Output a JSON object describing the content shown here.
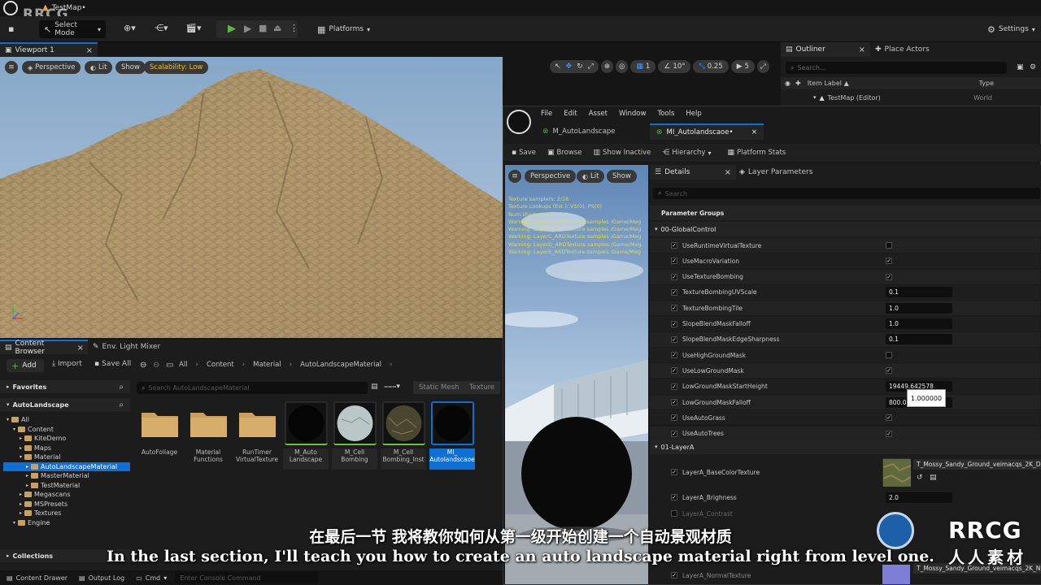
{
  "window": {
    "title": "TestMap•",
    "logo_text": "RRCG"
  },
  "toolbar": {
    "mode_label": "Select Mode",
    "platforms_label": "Platforms",
    "settings_label": "Settings"
  },
  "viewport": {
    "tab_label": "Viewport 1",
    "perspective_label": "Perspective",
    "lit_label": "Lit",
    "show_label": "Show",
    "scalability_label": "Scalability: Low",
    "grid_value": "1",
    "angle_value": "10°",
    "scale_value": "0.25",
    "camera_speed": "5"
  },
  "outliner": {
    "tab_label": "Outliner",
    "place_actors_label": "Place Actors",
    "search_placeholder": "Search...",
    "col_label": "Item Label ▲",
    "col_type": "Type",
    "row_label": "TestMap (Editor)",
    "row_type": "World"
  },
  "content_browser": {
    "tab_label": "Content Browser",
    "mixer_tab_label": "Env. Light Mixer",
    "add_label": "Add",
    "import_label": "Import",
    "save_all_label": "Save All",
    "breadcrumbs": [
      "All",
      "Content",
      "Material",
      "AutoLandscapeMaterial"
    ],
    "favorites_label": "Favorites",
    "project_label": "AutoLandscape",
    "search_placeholder": "Search AutoLandscapeMaterial",
    "filter_static_mesh": "Static Mesh",
    "filter_texture": "Texture",
    "tree": [
      {
        "label": "All",
        "level": 0,
        "selected": false
      },
      {
        "label": "Content",
        "level": 1,
        "selected": false
      },
      {
        "label": "KiteDemo",
        "level": 2,
        "selected": false
      },
      {
        "label": "Maps",
        "level": 2,
        "selected": false
      },
      {
        "label": "Material",
        "level": 2,
        "selected": false
      },
      {
        "label": "AutoLandscapeMaterial",
        "level": 3,
        "selected": true
      },
      {
        "label": "MasterMaterial",
        "level": 3,
        "selected": false
      },
      {
        "label": "TestMaterial",
        "level": 3,
        "selected": false
      },
      {
        "label": "Megascans",
        "level": 2,
        "selected": false
      },
      {
        "label": "MSPresets",
        "level": 2,
        "selected": false
      },
      {
        "label": "Textures",
        "level": 2,
        "selected": false
      },
      {
        "label": "Engine",
        "level": 1,
        "selected": false
      }
    ],
    "assets": [
      {
        "label": "AutoFoliage",
        "kind": "folder"
      },
      {
        "label": "Material Functions",
        "kind": "folder"
      },
      {
        "label": "RunTimer VirtualTexture",
        "kind": "folder"
      },
      {
        "label": "M_Auto Landscape",
        "kind": "material-black"
      },
      {
        "label": "M_Cell Bombing",
        "kind": "material-white"
      },
      {
        "label": "M_Cell Bombing_Inst",
        "kind": "material-rock"
      },
      {
        "label": "MI_ Autolandscaoe",
        "kind": "material-selected"
      }
    ],
    "collections_label": "Collections",
    "content_drawer_label": "Content Drawer",
    "output_log_label": "Output Log",
    "cmd_label": "Cmd",
    "console_placeholder": "Enter Console Command"
  },
  "material_editor": {
    "menu": [
      "File",
      "Edit",
      "Asset",
      "Window",
      "Tools",
      "Help"
    ],
    "tabs": [
      {
        "label": "M_AutoLandscape",
        "active": false
      },
      {
        "label": "MI_Autolandscaoe•",
        "active": true
      }
    ],
    "toolbar": {
      "save": "Save",
      "browse": "Browse",
      "show_inactive": "Show Inactive",
      "hierarchy": "Hierarchy",
      "platform_stats": "Platform Stats"
    },
    "preview": {
      "perspective_label": "Perspective",
      "lit_label": "Lit",
      "show_label": "Show",
      "stats_lines": [
        "Texture samplers: 2/16",
        "Texture Lookups (Est.): VS(0), PS(0)",
        "Num shaders added: 0",
        "Warning: LayerA_ARDTexture samples /Game/Meg",
        "Warning: LayerB_ARDTexture samples /Game/Meg",
        "Warning: LayerC_ARDTexture samples /Game/Meg",
        "Warning: LayerD_ARDTexture samples /Game/Meg",
        "Warning: LayerE_ARDTexture samples /Game/Meg"
      ]
    },
    "details": {
      "tab_label": "Details",
      "layer_tab_label": "Layer Parameters",
      "search_placeholder": "Search",
      "group_header": "Parameter Groups",
      "group_global": "00-GlobalControl",
      "group_layer_a": "01-LayerA",
      "tooltip_value": "1.000000",
      "params": [
        {
          "name": "UseRuntimeVirtualTexture",
          "type": "bool",
          "value": "",
          "enabled": true
        },
        {
          "name": "UseMacroVariation",
          "type": "bool",
          "value": "✓",
          "enabled": true
        },
        {
          "name": "UseTextureBombing",
          "type": "bool",
          "value": "✓",
          "enabled": true
        },
        {
          "name": "TextureBombingUVScale",
          "type": "num",
          "value": "0.1",
          "enabled": true
        },
        {
          "name": "TextureBombingTile",
          "type": "num",
          "value": "1.0",
          "enabled": true
        },
        {
          "name": "SlopeBlendMaskFalloff",
          "type": "num",
          "value": "1.0",
          "enabled": true
        },
        {
          "name": "SlopeBlendMaskEdgeSharpness",
          "type": "num",
          "value": "0.1",
          "enabled": true
        },
        {
          "name": "UseHighGroundMask",
          "type": "bool",
          "value": "",
          "enabled": true
        },
        {
          "name": "UseLowGroundMask",
          "type": "bool",
          "value": "✓",
          "enabled": true
        },
        {
          "name": "LowGroundMaskStartHeight",
          "type": "num",
          "value": "19449.642578",
          "enabled": true
        },
        {
          "name": "LowGroundMaskFalloff",
          "type": "num",
          "value": "800.0",
          "enabled": true
        },
        {
          "name": "UseAutoGrass",
          "type": "bool",
          "value": "✓",
          "enabled": true
        },
        {
          "name": "UseAutoTrees",
          "type": "bool",
          "value": "✓",
          "enabled": true
        }
      ],
      "layer_a_texture_param": "LayerA_BaseColorTexture",
      "layer_a_texture_value": "T_Mossy_Sandy_Ground_veimacqs_2K_D",
      "layer_a_brightness_label": "LayerA_Brighness",
      "layer_a_brightness_value": "2.0",
      "layer_a_contrast_label": "LayerA_Contrast",
      "layer_a_normal_label": "LayerA_NormalTexture",
      "layer_a_normal_value": "T_Mossy_Sandy_Ground_veimacqs_2K_N"
    }
  },
  "subtitles": {
    "cn": "在最后一节 我将教你如何从第一级开始创建一个自动景观材质",
    "en": "In the last section, I'll teach you how to create an auto landscape material right from level one."
  },
  "watermark": {
    "brand": "RRCG",
    "cn": "人人素材"
  },
  "colors": {
    "accent_blue": "#0e70d6",
    "folder": "#c8a061",
    "scalability_yellow": "#e5c23a",
    "panel": "#1c1c1c",
    "warning_text": "#d8d86a"
  }
}
